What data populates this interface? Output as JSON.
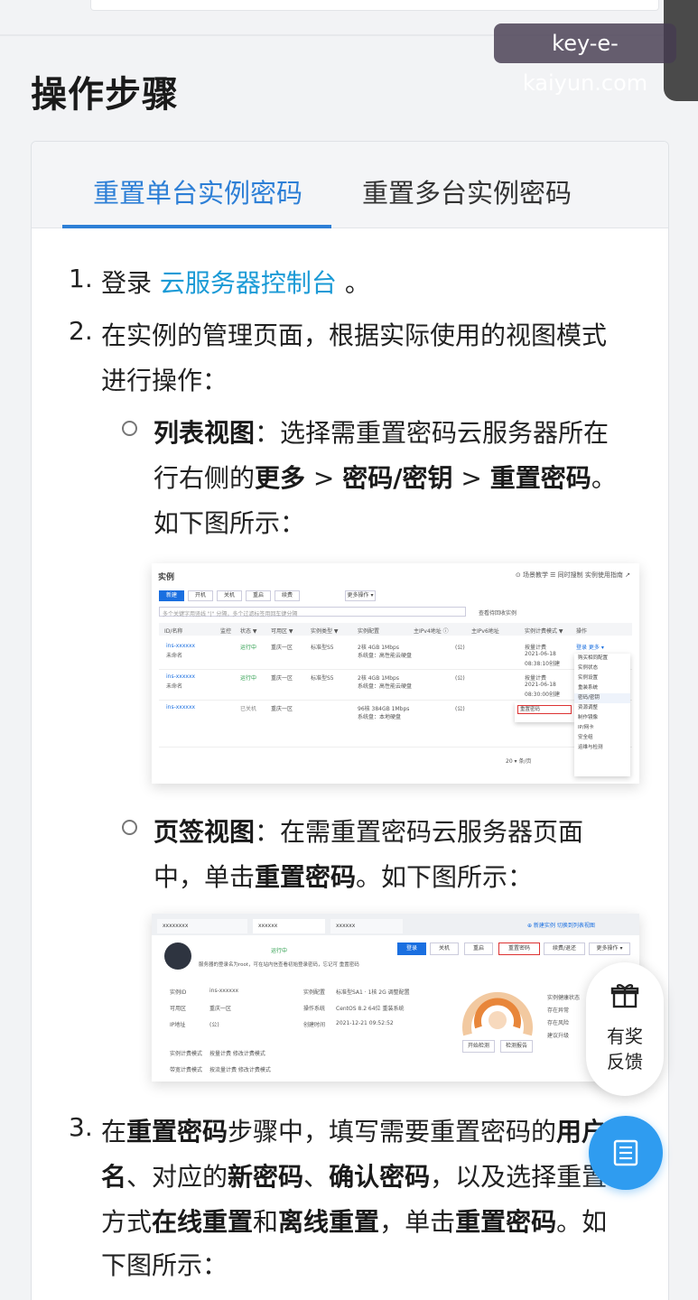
{
  "watermark": "key-e-kaiyun.com",
  "heading": "操作步骤",
  "tabs": [
    {
      "label": "重置单台实例密码",
      "active": true
    },
    {
      "label": "重置多台实例密码",
      "active": false
    }
  ],
  "steps": {
    "s1": {
      "num": "1.",
      "pre": "登录 ",
      "link": "云服务器控制台",
      "post": " 。"
    },
    "s2": {
      "num": "2.",
      "line1": "在实例的管理页面，根据实际使用的视图模式",
      "line2": "进行操作："
    },
    "list_view": {
      "title": "列表视图",
      "line1_rest": "：选择需重置密码云服务器所在",
      "line2_pre": "行右侧的",
      "more": "更多",
      "gt": " > ",
      "pwd_key": "密码/密钥",
      "reset": "重置密码",
      "period": "。",
      "line3": "如下图所示："
    },
    "tab_view": {
      "title": "页签视图",
      "line1_rest": "：在需重置密码云服务器页面",
      "line2_pre": "中，单击",
      "reset": "重置密码",
      "line2_post": "。如下图所示："
    },
    "s3": {
      "num": "3.",
      "l1_a": "在",
      "l1_b": "重置密码",
      "l1_c": "步骤中，填写需要重置密码的",
      "l1_d": "用户",
      "l2_a": "名",
      "l2_b": "、对应的",
      "l2_c": "新密码",
      "l2_d": "、",
      "l2_e": "确认密码",
      "l2_f": "，以及选择重置",
      "l3_a": "方式",
      "l3_b": "在线重置",
      "l3_c": "和",
      "l3_d": "离线重置",
      "l3_e": "，单击",
      "l3_f": "重置密码",
      "l3_g": "。如",
      "l4": "下图所示："
    }
  },
  "screenshot1": {
    "title": "实例",
    "top_links": "⊙ 场景教学   ☰ 同时搜制   实例使用指南 ↗",
    "buttons": [
      "新建",
      "开机",
      "关机",
      "重启",
      "续费",
      "更多操作 ▾"
    ],
    "search_placeholder": "多个关键字用竖线 \"|\" 分隔，多个过滤标签用回车键分隔",
    "recycle": "查看待回收实例",
    "headers": [
      "ID/名称",
      "监控",
      "状态 ▼",
      "可用区 ▼",
      "实例类型 ▼",
      "实例配置",
      "主IPv4地址 ⓘ",
      "主IPv6地址",
      "实例计费模式 ▼",
      "操作"
    ],
    "rows": [
      {
        "id": "ins-xxxxxx",
        "name": "未命名",
        "status": "运行中",
        "zone": "重庆一区",
        "type": "标准型S5",
        "config": "2核 4GB 1Mbps",
        "sys": "系统盘：高性能云硬盘",
        "ip": "(公)",
        "billing": "按量计费",
        "date": "2021-06-18",
        "time": "08:38:10创建",
        "ops": "登录  更多 ▾"
      },
      {
        "id": "ins-xxxxxx",
        "name": "未命名",
        "status": "运行中",
        "zone": "重庆一区",
        "type": "标准型S5",
        "config": "2核 4GB 1Mbps",
        "sys": "系统盘：高性能云硬盘",
        "ip": "(公)",
        "billing": "按量计费",
        "date": "2021-06-18",
        "time": "08:30:00创建",
        "ops": ""
      },
      {
        "id": "ins-xxxxxx",
        "name": "",
        "status": "已关机",
        "zone": "重庆一区",
        "type": "",
        "config": "96核 384GB 1Mbps",
        "sys": "系统盘：本地硬盘",
        "ip": "(公)",
        "billing": "",
        "date": "",
        "time": "",
        "ops": ""
      }
    ],
    "menu": [
      "购买相同配置",
      "实例状态",
      "实例设置",
      "重装系统",
      "密码/密钥",
      "资源调整",
      "制作镜像",
      "IP/网卡",
      "安全组",
      "运维与检测"
    ],
    "submenu": "重置密码",
    "pager": "20 ▾ 条/页"
  },
  "screenshot2": {
    "tabs": [
      "xxxxxxxx",
      "xxxxxx",
      "xxxxxx"
    ],
    "top_right": "⊕ 新建实例     切换到列表视图",
    "instance_status": "运行中",
    "notice": "服务器的登录名为root，可在站内信查看初始登录密码，忘记可 重置密码",
    "buttons": [
      "登录",
      "关机",
      "重启",
      "重置密码",
      "续费/退还",
      "更多操作 ▾"
    ],
    "fields": [
      {
        "label": "实例ID",
        "value": "ins-xxxxxx"
      },
      {
        "label": "可用区",
        "value": "重庆一区"
      },
      {
        "label": "IP地址",
        "value": "(公)"
      },
      {
        "label": "实例计费模式",
        "value": "按量计费  修改计费模式"
      },
      {
        "label": "带宽计费模式",
        "value": "按流量计费  修改计费模式"
      }
    ],
    "config": [
      {
        "label": "实例配置",
        "value": "标准型SA1 · 1核 2G  调整配置"
      },
      {
        "label": "操作系统",
        "value": "CentOS 8.2 64位  重装系统"
      },
      {
        "label": "创建时间",
        "value": "2021-12-21 09:52:52"
      }
    ],
    "gauge_label": "开始检测",
    "gauge_btns": [
      "开始检测",
      "检测报告"
    ],
    "health": "实例健康状态",
    "health_items": [
      "存在异常",
      "存在风险",
      "建议升级"
    ]
  },
  "float_reward": {
    "line1": "有奖",
    "line2": "反馈"
  }
}
